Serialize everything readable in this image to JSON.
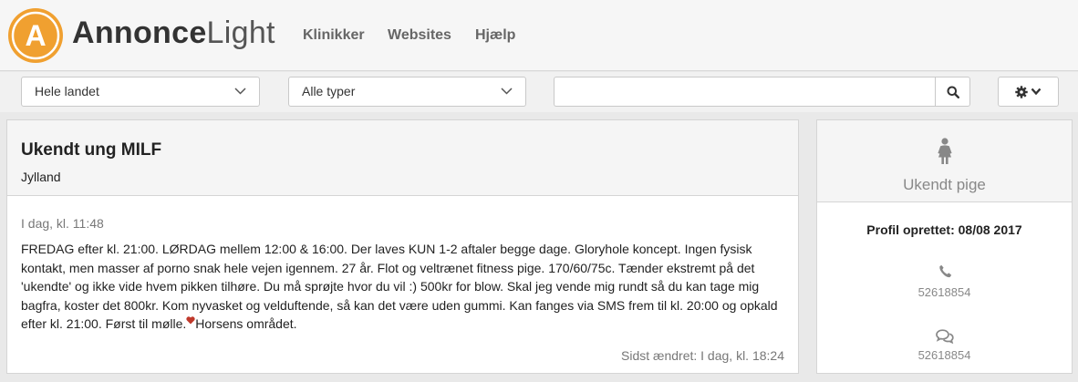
{
  "brand": {
    "name_bold": "Annonce",
    "name_light": "Light",
    "logo_letter": "A",
    "color": "#f0a030"
  },
  "nav": [
    {
      "label": "Klinikker"
    },
    {
      "label": "Websites"
    },
    {
      "label": "Hjælp"
    }
  ],
  "filters": {
    "region": "Hele landet",
    "type": "Alle typer",
    "search_value": "",
    "search_placeholder": ""
  },
  "ad": {
    "title": "Ukendt ung MILF",
    "region": "Jylland",
    "posted": "I dag, kl. 11:48",
    "text_main": "FREDAG efter kl. 21:00. LØRDAG mellem 12:00 & 16:00. Der laves KUN 1-2 aftaler begge dage. Gloryhole koncept. Ingen fysisk kontakt, men masser af porno snak hele vejen igennem. 27 år. Flot og veltrænet fitness pige. 170/60/75c. Tænder ekstremt på det 'ukendte' og ikke vide hvem pikken tilhøre. Du må sprøjte hvor du vil :) 500kr for blow. Skal jeg vende mig rundt så du kan tage mig bagfra, koster det 800kr. Kom nyvasket og velduftende, så kan det være uden gummi. Kan fanges via SMS frem til kl. 20:00 og opkald efter kl. 21:00. Først til mølle.",
    "text_tail": "Horsens området.",
    "modified": "Sidst ændret: I dag, kl. 18:24"
  },
  "profile": {
    "name": "Ukendt pige",
    "created": "Profil oprettet: 08/08 2017",
    "phone": "52618854",
    "sms": "52618854"
  }
}
